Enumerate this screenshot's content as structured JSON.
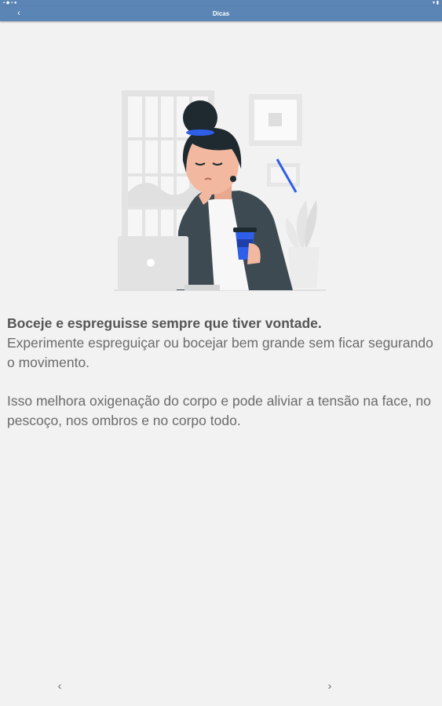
{
  "status": {
    "left_icons": "▪ ◆ ▪ ●",
    "right_icons": "▾ ▮"
  },
  "appbar": {
    "back_glyph": "‹",
    "title": "Dicas"
  },
  "tip": {
    "headline": "Boceje e espreguisse sempre que tiver vontade.",
    "line1": "Experimente espreguiçar ou bocejar bem grande sem ficar segurando o movimento.",
    "line2": "Isso melhora oxigenação do corpo e pode aliviar a tensão na face, no pescoço, nos ombros e no corpo todo."
  },
  "nav": {
    "prev_glyph": "‹",
    "next_glyph": "›"
  },
  "colors": {
    "appbar": "#5b85b5",
    "background": "#f2f2f2",
    "accent_blue": "#2f5ee8",
    "jacket": "#3e4a52",
    "hair": "#1f2a30",
    "skin": "#f2b9a0"
  },
  "icons": [
    "back-icon",
    "prev-page-icon",
    "next-page-icon"
  ]
}
